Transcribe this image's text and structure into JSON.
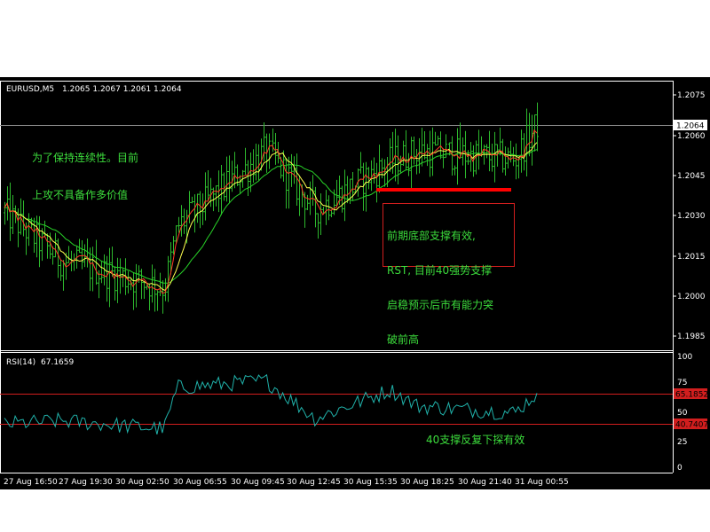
{
  "header": {
    "symbol": "EURUSD,M5",
    "ohlc": "1.2065 1.2067 1.2061 1.2064"
  },
  "colors": {
    "background": "#000000",
    "bars": "#2db82d",
    "ma_fast": "#ff3c28",
    "ma_mid": "#ffff50",
    "ma_slow": "#28d228",
    "rsi_line": "#20b2aa",
    "level_lines": "#d21e1e",
    "annotation_text": "#3cdc3c",
    "annotation_box_border": "#d21e1e",
    "marker_line": "#ff0000",
    "axis_text": "#ffffff"
  },
  "price_axis": {
    "ticks": [
      "1.2075",
      "1.2060",
      "1.2045",
      "1.2030",
      "1.2015",
      "1.2000",
      "1.1985"
    ],
    "current_price": "1.2064"
  },
  "rsi_panel": {
    "label": "RSI(14)",
    "value": "67.1659",
    "ticks": [
      "100",
      "75",
      "50",
      "25",
      "0"
    ],
    "levels": [
      "65.1852",
      "40.7407"
    ]
  },
  "time_axis": [
    "27 Aug 16:50",
    "27 Aug 19:30",
    "30 Aug 02:50",
    "30 Aug 06:55",
    "30 Aug 09:45",
    "30 Aug 12:45",
    "30 Aug 15:35",
    "30 Aug 18:25",
    "30 Aug 21:40",
    "31 Aug 00:55"
  ],
  "annotations": {
    "top_left": [
      "为了保持连续性。目前",
      "上攻不具备作多价值"
    ],
    "box": [
      "前期底部支撑有效,",
      "RST, 目前40强势支撑",
      "启稳预示后市有能力突",
      "破前高"
    ],
    "rsi": "40支撑反复下探有效"
  },
  "chart_data": [
    {
      "type": "line",
      "title": "EURUSD,M5",
      "x": [
        "27 Aug 16:50",
        "27 Aug 19:30",
        "30 Aug 02:50",
        "30 Aug 06:55",
        "30 Aug 09:45",
        "30 Aug 12:45",
        "30 Aug 15:35",
        "30 Aug 18:25",
        "30 Aug 21:40",
        "31 Aug 00:55"
      ],
      "series": [
        {
          "values": [
            1.2031,
            1.2013,
            1.2003,
            1.2026,
            1.2054,
            1.2032,
            1.205,
            1.2054,
            1.2051,
            1.2064
          ]
        }
      ],
      "ylim": [
        1.1979,
        1.2081
      ],
      "grid": false
    },
    {
      "type": "line",
      "title": "RSI(14)",
      "x": [
        "27 Aug 16:50",
        "27 Aug 19:30",
        "30 Aug 02:50",
        "30 Aug 06:55",
        "30 Aug 09:45",
        "30 Aug 12:45",
        "30 Aug 15:35",
        "30 Aug 18:25",
        "30 Aug 21:40",
        "31 Aug 00:55"
      ],
      "series": [
        {
          "values": [
            40,
            43,
            36,
            72,
            78,
            45,
            70,
            56,
            50,
            67.17
          ]
        }
      ],
      "levels": [
        65.1852,
        40.7407
      ],
      "ylim": [
        0,
        100
      ]
    }
  ]
}
